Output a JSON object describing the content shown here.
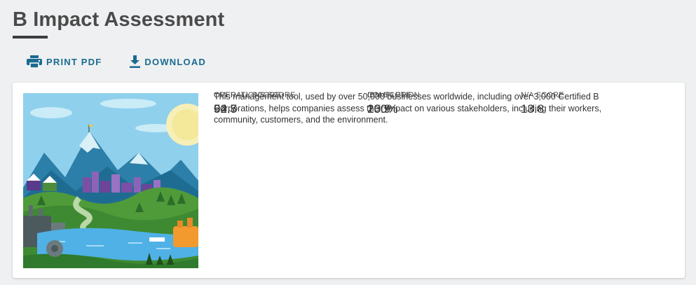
{
  "header": {
    "title": "B Impact Assessment"
  },
  "toolbar": {
    "print_label": "PRINT PDF",
    "print_icon": "printer-icon",
    "download_label": "DOWNLOAD",
    "download_icon": "download-icon",
    "accent_color": "#1b6a8f"
  },
  "card": {
    "description": "This management tool, used by over 50,000 businesses worldwide, including over 3,000 Certified B Corporations, helps companies assess their impact on various stakeholders, including their workers, community, customers, and the environment.",
    "stats": {
      "overall": {
        "label": "OVERALL SCORE",
        "value": "92.5"
      },
      "completion": {
        "label": "COMPLETION",
        "value": "100%"
      },
      "operations": {
        "label": "OPERATIONS SCORE",
        "value": "54.7"
      },
      "ibm": {
        "label": "IBM SCORE",
        "value": "23.9"
      },
      "na": {
        "label": "N/A SCORE",
        "value": "13.8"
      }
    }
  }
}
